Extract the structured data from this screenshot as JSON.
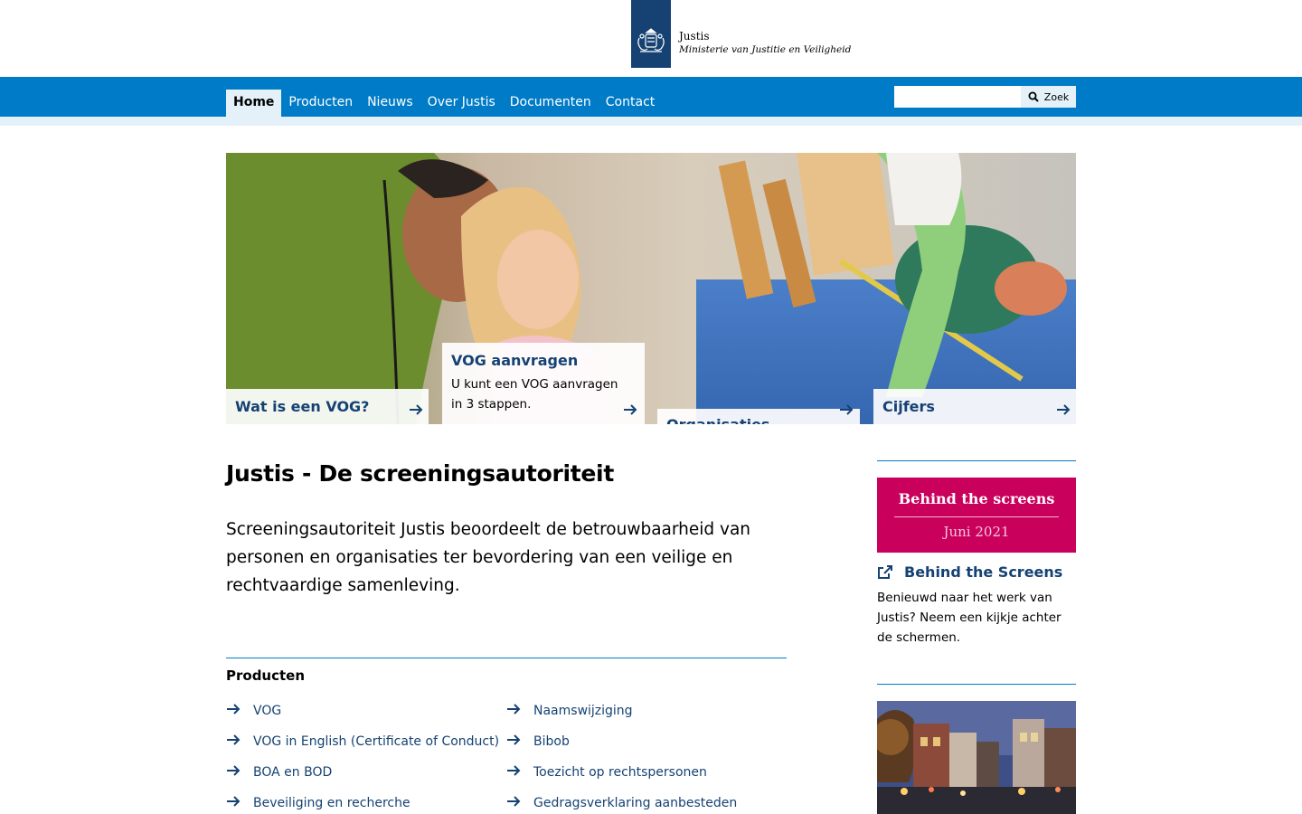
{
  "header": {
    "org_name": "Justis",
    "ministry": "Ministerie van Justitie en Veiligheid"
  },
  "nav": {
    "items": [
      {
        "label": "Home",
        "active": true
      },
      {
        "label": "Producten"
      },
      {
        "label": "Nieuws"
      },
      {
        "label": "Over Justis"
      },
      {
        "label": "Documenten"
      },
      {
        "label": "Contact"
      }
    ]
  },
  "search": {
    "placeholder": "",
    "button_label": "Zoek"
  },
  "hero": {
    "tiles": [
      {
        "title": "Wat is een VOG?"
      },
      {
        "title": "VOG aanvragen",
        "text_line1": "U kunt een VOG aanvragen",
        "text_line2": "in 3 stappen."
      },
      {
        "title": "Organisaties"
      },
      {
        "title": "Cijfers"
      }
    ]
  },
  "main": {
    "title": "Justis - De screeningsautoriteit",
    "intro": "Screeningsautoriteit Justis beoordeelt de betrouwbaarheid van personen en organisaties ter bevordering van een veilige en rechtvaardige samenleving.",
    "products_heading": "Producten",
    "products_left": [
      "VOG",
      "VOG in English (Certificate of Conduct)",
      "BOA en BOD",
      "Beveiliging en recherche"
    ],
    "products_right": [
      "Naamswijziging",
      "Bibob",
      "Toezicht op rechtspersonen",
      "Gedragsverklaring aanbesteden"
    ]
  },
  "sidebar": {
    "banner_title": "Behind the screens",
    "banner_subtitle": "Juni 2021",
    "link_title": "Behind the Screens",
    "link_text": "Benieuwd naar het werk van Justis? Neem een kijkje achter de schermen."
  },
  "colors": {
    "brand_blue": "#007bc7",
    "dark_blue": "#154273",
    "light_blue": "#e5f1f9",
    "banner_pink": "#ca005d"
  }
}
